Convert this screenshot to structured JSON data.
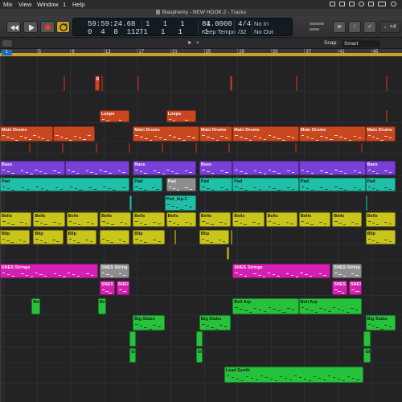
{
  "menubar": {
    "items": [
      "Mix",
      "View",
      "Window",
      "1",
      "Help"
    ]
  },
  "window": {
    "title": "Blasphemy - NEW HOOK 2 - Tracks"
  },
  "transport": {
    "time_smpte": "59:59:24.68",
    "time_bars": "1   1   1     1",
    "bar_pos": "0  4  8  112",
    "beat_pos": "71   1   1     1",
    "tempo": "84.0000",
    "tempo_mode": "Keep Tempo",
    "time_sig": "4/4",
    "division": "/32",
    "midi_in": "No In",
    "midi_out": "No Out",
    "count_in": "♩=4"
  },
  "editbar": {
    "snap_label": "Snap:",
    "snap_value": "Smart"
  },
  "ruler": {
    "labels": [
      "1",
      "5",
      "9",
      "13",
      "17",
      "21",
      "25",
      "29",
      "33",
      "37",
      "41",
      "45",
      "49"
    ]
  },
  "colors": {
    "red": "#d2412a",
    "orange": "#c8471f",
    "purple": "#7a3fd6",
    "teal": "#1fbfa8",
    "yellow": "#c9c51a",
    "magenta": "#d41fb1",
    "green": "#27c23b",
    "gray": "#8e8e8e"
  },
  "regions": [
    {
      "label": "",
      "color": "red",
      "lane": 0,
      "bar": 19.0,
      "len": 0.4
    },
    {
      "label": "R Rev",
      "color": "red",
      "lane": 0,
      "bar": 28.5,
      "len": 1.6
    },
    {
      "label": "",
      "color": "red",
      "lane": 0,
      "bar": 30.6,
      "len": 0.4
    },
    {
      "label": "",
      "color": "red",
      "lane": 0,
      "bar": 41.5,
      "len": 0.4
    },
    {
      "label": "Rev",
      "color": "red",
      "lane": 0,
      "bar": 69.3,
      "len": 0.7
    },
    {
      "label": "",
      "color": "red",
      "lane": 0,
      "bar": 89.0,
      "len": 0.4
    },
    {
      "label": "",
      "color": "red",
      "lane": 0,
      "bar": 116.2,
      "len": 0.4
    },
    {
      "label": "Loops",
      "color": "orange",
      "lane": 1,
      "bar": 30.0,
      "len": 9.0
    },
    {
      "label": "Loops",
      "color": "orange",
      "lane": 1,
      "bar": 50.0,
      "len": 9.0
    },
    {
      "label": "",
      "color": "orange",
      "lane": 1,
      "bar": 116.2,
      "len": 0.5
    },
    {
      "label": "Main Drums",
      "color": "orange",
      "lane": 2,
      "bar": 0.0,
      "len": 16.0
    },
    {
      "label": "",
      "color": "orange",
      "lane": 2,
      "bar": 16.0,
      "len": 12.5
    },
    {
      "label": "Main Drums",
      "color": "orange",
      "lane": 2,
      "bar": 40.0,
      "len": 20.0
    },
    {
      "label": "Main Drums",
      "color": "orange",
      "lane": 2,
      "bar": 60.0,
      "len": 10.0
    },
    {
      "label": "Main Drums",
      "color": "orange",
      "lane": 2,
      "bar": 70.0,
      "len": 20.0
    },
    {
      "label": "Main Drums",
      "color": "orange",
      "lane": 2,
      "bar": 90.0,
      "len": 20.0
    },
    {
      "label": "Main Drums",
      "color": "orange",
      "lane": 2,
      "bar": 110.0,
      "len": 9.0
    },
    {
      "label": "",
      "color": "orange",
      "lane": 3,
      "bar": 8.8,
      "len": 0.5
    },
    {
      "label": "",
      "color": "orange",
      "lane": 3,
      "bar": 18.7,
      "len": 0.5
    },
    {
      "label": "",
      "color": "orange",
      "lane": 3,
      "bar": 28.7,
      "len": 0.5
    },
    {
      "label": "",
      "color": "orange",
      "lane": 3,
      "bar": 38.7,
      "len": 0.5
    },
    {
      "label": "",
      "color": "orange",
      "lane": 3,
      "bar": 48.7,
      "len": 0.5
    },
    {
      "label": "",
      "color": "orange",
      "lane": 3,
      "bar": 58.7,
      "len": 0.5
    },
    {
      "label": "",
      "color": "orange",
      "lane": 3,
      "bar": 68.7,
      "len": 0.5
    },
    {
      "label": "",
      "color": "orange",
      "lane": 3,
      "bar": 88.7,
      "len": 0.5
    },
    {
      "label": "",
      "color": "orange",
      "lane": 3,
      "bar": 108.7,
      "len": 0.5
    },
    {
      "label": "Bass",
      "color": "purple",
      "lane": 4,
      "bar": 0.0,
      "len": 19.5
    },
    {
      "label": "",
      "color": "purple",
      "lane": 4,
      "bar": 19.5,
      "len": 19.5
    },
    {
      "label": "Bass",
      "color": "purple",
      "lane": 4,
      "bar": 40.0,
      "len": 19.0
    },
    {
      "label": "Bass",
      "color": "purple",
      "lane": 4,
      "bar": 60.0,
      "len": 10.0
    },
    {
      "label": "",
      "color": "purple",
      "lane": 4,
      "bar": 70.0,
      "len": 20.0
    },
    {
      "label": "",
      "color": "purple",
      "lane": 4,
      "bar": 90.0,
      "len": 20.0
    },
    {
      "label": "Bass",
      "color": "purple",
      "lane": 4,
      "bar": 110.0,
      "len": 9.0
    },
    {
      "label": "Pad",
      "color": "teal",
      "lane": 5,
      "bar": 0.0,
      "len": 39.0
    },
    {
      "label": "Pad",
      "color": "teal",
      "lane": 5,
      "bar": 40.0,
      "len": 9.0
    },
    {
      "label": "Pad",
      "color": "gray",
      "lane": 5,
      "bar": 50.0,
      "len": 9.0
    },
    {
      "label": "Pad",
      "color": "teal",
      "lane": 5,
      "bar": 60.0,
      "len": 10.0
    },
    {
      "label": "Pad",
      "color": "teal",
      "lane": 5,
      "bar": 70.0,
      "len": 20.0
    },
    {
      "label": "Pad",
      "color": "teal",
      "lane": 5,
      "bar": 90.0,
      "len": 20.0
    },
    {
      "label": "Pad",
      "color": "teal",
      "lane": 5,
      "bar": 110.0,
      "len": 9.0
    },
    {
      "label": "",
      "color": "teal",
      "lane": 6,
      "bar": 39.0,
      "len": 0.6
    },
    {
      "label": "Pad_bip.2",
      "color": "teal",
      "lane": 6,
      "bar": 49.5,
      "len": 9.5
    },
    {
      "label": "",
      "color": "teal",
      "lane": 6,
      "bar": 110.0,
      "len": 0.6
    },
    {
      "label": "Bells",
      "color": "yellow",
      "lane": 7,
      "bar": 0.0,
      "len": 9.5
    },
    {
      "label": "Bells",
      "color": "yellow",
      "lane": 7,
      "bar": 10.0,
      "len": 9.5
    },
    {
      "label": "Bells",
      "color": "yellow",
      "lane": 7,
      "bar": 20.0,
      "len": 9.5
    },
    {
      "label": "Bells",
      "color": "yellow",
      "lane": 7,
      "bar": 30.0,
      "len": 9.5
    },
    {
      "label": "Bells",
      "color": "yellow",
      "lane": 7,
      "bar": 40.0,
      "len": 9.5
    },
    {
      "label": "Bells",
      "color": "yellow",
      "lane": 7,
      "bar": 50.0,
      "len": 9.0
    },
    {
      "label": "Bells",
      "color": "yellow",
      "lane": 7,
      "bar": 60.0,
      "len": 9.5
    },
    {
      "label": "Bells",
      "color": "yellow",
      "lane": 7,
      "bar": 70.0,
      "len": 9.5
    },
    {
      "label": "Bells",
      "color": "yellow",
      "lane": 7,
      "bar": 80.0,
      "len": 9.5
    },
    {
      "label": "Bells",
      "color": "yellow",
      "lane": 7,
      "bar": 90.0,
      "len": 9.5
    },
    {
      "label": "Bells",
      "color": "yellow",
      "lane": 7,
      "bar": 100.0,
      "len": 9.0
    },
    {
      "label": "Bells",
      "color": "yellow",
      "lane": 7,
      "bar": 110.0,
      "len": 9.0
    },
    {
      "label": "Blip",
      "color": "yellow",
      "lane": 8,
      "bar": 0.0,
      "len": 9.0
    },
    {
      "label": "Blip",
      "color": "yellow",
      "lane": 8,
      "bar": 10.0,
      "len": 9.0
    },
    {
      "label": "Blip",
      "color": "yellow",
      "lane": 8,
      "bar": 20.0,
      "len": 9.0
    },
    {
      "label": "",
      "color": "yellow",
      "lane": 8,
      "bar": 30.0,
      "len": 9.0
    },
    {
      "label": "Blip",
      "color": "yellow",
      "lane": 8,
      "bar": 40.0,
      "len": 9.5
    },
    {
      "label": "",
      "color": "yellow",
      "lane": 8,
      "bar": 52.5,
      "len": 0.6
    },
    {
      "label": "Blip",
      "color": "yellow",
      "lane": 8,
      "bar": 60.0,
      "len": 9.0
    },
    {
      "label": "",
      "color": "yellow",
      "lane": 8,
      "bar": 69.5,
      "len": 0.5
    },
    {
      "label": "Blip",
      "color": "yellow",
      "lane": 8,
      "bar": 110.0,
      "len": 9.0
    },
    {
      "label": "",
      "color": "yellow",
      "lane": 9,
      "bar": 68.2,
      "len": 0.7
    },
    {
      "label": "SNES Strings",
      "color": "magenta",
      "lane": 10,
      "bar": 0.0,
      "len": 29.5
    },
    {
      "label": "SNES String",
      "color": "gray",
      "lane": 10,
      "bar": 30.0,
      "len": 9.0
    },
    {
      "label": "SNES Strings",
      "color": "magenta",
      "lane": 10,
      "bar": 70.0,
      "len": 29.5
    },
    {
      "label": "SNES String",
      "color": "gray",
      "lane": 10,
      "bar": 100.0,
      "len": 9.0
    },
    {
      "label": "SNES",
      "color": "magenta",
      "lane": 11,
      "bar": 30.0,
      "len": 4.5
    },
    {
      "label": "SNES",
      "color": "magenta",
      "lane": 11,
      "bar": 35.0,
      "len": 4.0
    },
    {
      "label": "SNES",
      "color": "magenta",
      "lane": 11,
      "bar": 100.0,
      "len": 4.5
    },
    {
      "label": "SNES",
      "color": "magenta",
      "lane": 11,
      "bar": 105.0,
      "len": 4.0
    },
    {
      "label": "Bel",
      "color": "green",
      "lane": 12,
      "bar": 9.5,
      "len": 2.5
    },
    {
      "label": "Bel",
      "color": "green",
      "lane": 12,
      "bar": 29.5,
      "len": 2.5
    },
    {
      "label": "Bell Arp",
      "color": "green",
      "lane": 12,
      "bar": 70.0,
      "len": 20.0
    },
    {
      "label": "Bell Arp",
      "color": "green",
      "lane": 12,
      "bar": 90.0,
      "len": 19.0
    },
    {
      "label": "Big Stabs",
      "color": "green",
      "lane": 13,
      "bar": 40.0,
      "len": 9.5
    },
    {
      "label": "Big Stabs",
      "color": "green",
      "lane": 13,
      "bar": 60.0,
      "len": 9.5
    },
    {
      "label": "Big Stabs",
      "color": "green",
      "lane": 13,
      "bar": 110.0,
      "len": 9.0
    },
    {
      "label": "",
      "color": "green",
      "lane": 14,
      "bar": 39.0,
      "len": 2.0
    },
    {
      "label": "",
      "color": "green",
      "lane": 14,
      "bar": 59.0,
      "len": 2.0
    },
    {
      "label": "",
      "color": "green",
      "lane": 14,
      "bar": 109.5,
      "len": 2.0
    },
    {
      "label": "GB",
      "color": "green",
      "lane": 15,
      "bar": 39.0,
      "len": 2.0
    },
    {
      "label": "GB",
      "color": "green",
      "lane": 15,
      "bar": 59.0,
      "len": 2.0
    },
    {
      "label": "GB",
      "color": "green",
      "lane": 15,
      "bar": 109.5,
      "len": 2.0
    },
    {
      "label": "GB",
      "color": "green",
      "lane": 16,
      "bar": 39.0,
      "len": 2.0
    },
    {
      "label": "GB",
      "color": "green",
      "lane": 16,
      "bar": 59.0,
      "len": 2.0
    },
    {
      "label": "GB",
      "color": "green",
      "lane": 16,
      "bar": 109.5,
      "len": 2.0
    },
    {
      "label": "Lead Synth",
      "color": "green",
      "lane": 17,
      "bar": 67.5,
      "len": 42.0
    }
  ]
}
